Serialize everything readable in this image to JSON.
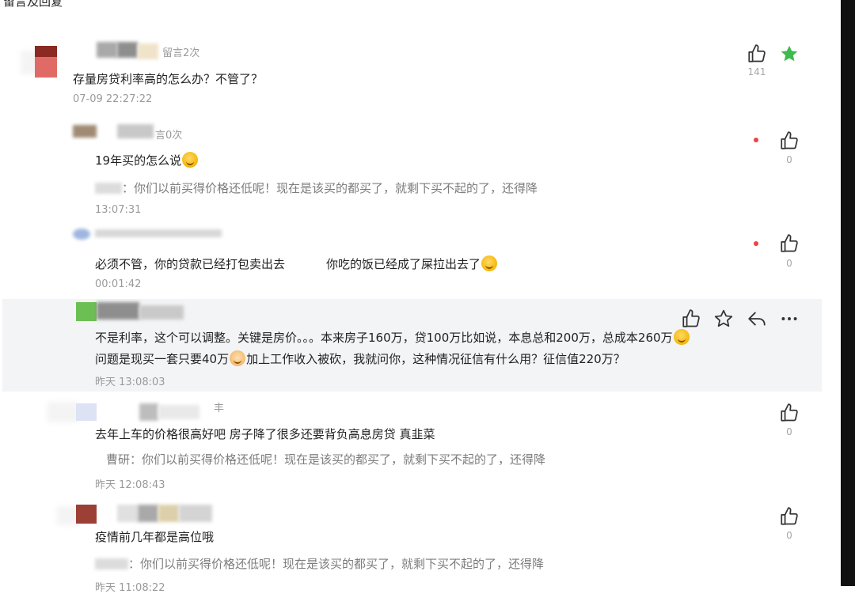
{
  "page": {
    "title": "留言及回复"
  },
  "comments": [
    {
      "meta": "留言2次",
      "text": "存量房贷利率高的怎么办？不管了？",
      "time": "07-09 22:27:22",
      "likes": "141",
      "starred": true
    },
    {
      "meta": "言0次",
      "text": "19年买的怎么说",
      "quote_prefix": "：",
      "quote": "你们以前买得价格还低呢！现在是该买的都买了，就剩下买不起的了，还得降",
      "time": "13:07:31",
      "likes": "0"
    },
    {
      "text_a": "必须不管，你的贷款已经打包卖出去",
      "text_b": "你吃的饭已经成了屎拉出去了",
      "time": "00:01:42",
      "likes": "0"
    },
    {
      "line1": "不是利率，这个可以调整。关键是房价。。。本来房子160万，贷100万比如说，本息总和200万，总成本260万",
      "line2a": "问题是现买一套只要40万",
      "line2b": "加上工作收入被砍，我就问你，这种情况征信有什么用？征信值220万？",
      "time": "昨天 13:08:03"
    },
    {
      "meta": "丰",
      "text": "去年上车的价格很高好吧 房子降了很多还要背负高息房贷 真韭菜",
      "quote_name": "曹研",
      "quote_prefix": "：",
      "quote": "你们以前买得价格还低呢！现在是该买的都买了，就剩下买不起的了，还得降",
      "time": "昨天 12:08:43",
      "likes": "0"
    },
    {
      "text": "疫情前几年都是高位哦",
      "quote_prefix": "：",
      "quote": "你们以前买得价格还低呢！现在是该买的都买了，就剩下买不起的了，还得降",
      "time": "昨天 11:08:22",
      "likes": "0"
    }
  ],
  "colors": {
    "star_active": "#3dbb4c",
    "red_dot": "#f04040",
    "highlight_bg": "#f3f4f6"
  },
  "icons": {
    "like": "thumbs-up-icon",
    "star": "star-icon",
    "reply": "reply-icon",
    "more": "more-icon"
  }
}
